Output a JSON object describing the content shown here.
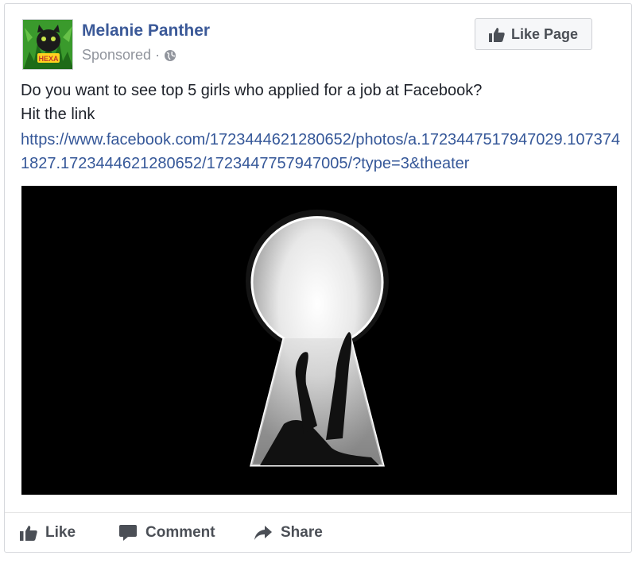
{
  "post": {
    "author": "Melanie Panther",
    "sponsored_label": "Sponsored",
    "separator": "·",
    "text_line_1": "Do you want to see top 5 girls who applied for a job at Facebook?",
    "text_line_2": "Hit the link",
    "link": "https://www.facebook.com/1723444621280652/photos/a.1723447517947029.1073741827.1723444621280652/1723447757947005/?type=3&theater"
  },
  "header": {
    "like_page_label": "Like Page",
    "avatar_text": "HEXA"
  },
  "actions": {
    "like": "Like",
    "comment": "Comment",
    "share": "Share"
  },
  "colors": {
    "author": "#3b5998",
    "link": "#365899",
    "text": "#1d2129",
    "muted": "#90949c"
  },
  "icons": {
    "privacy": "globe-icon",
    "like_page": "thumbs-up-icon",
    "like": "thumbs-up-icon",
    "comment": "speech-bubble-icon",
    "share": "share-arrow-icon"
  }
}
